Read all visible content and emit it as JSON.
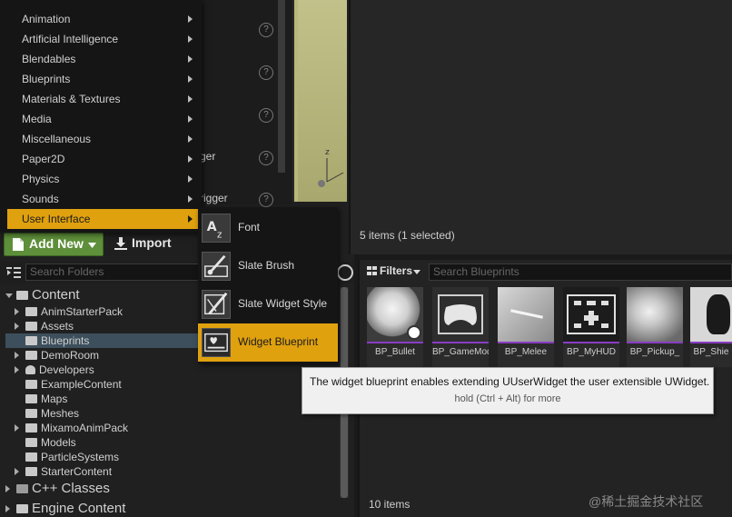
{
  "main_menu": {
    "items": [
      {
        "label": "Animation"
      },
      {
        "label": "Artificial Intelligence"
      },
      {
        "label": "Blendables"
      },
      {
        "label": "Blueprints"
      },
      {
        "label": "Materials & Textures"
      },
      {
        "label": "Media"
      },
      {
        "label": "Miscellaneous"
      },
      {
        "label": "Paper2D"
      },
      {
        "label": "Physics"
      },
      {
        "label": "Sounds"
      },
      {
        "label": "User Interface"
      }
    ]
  },
  "sub_menu": {
    "items": [
      {
        "label": "Font",
        "icon": "font-icon"
      },
      {
        "label": "Slate Brush",
        "icon": "slate-brush-icon"
      },
      {
        "label": "Slate Widget Style",
        "icon": "slate-widget-style-icon"
      },
      {
        "label": "Widget Blueprint",
        "icon": "widget-blueprint-icon"
      }
    ]
  },
  "details_fragments": {
    "a": "ger",
    "b": "rigger"
  },
  "toolbar": {
    "add_new_label": "Add New",
    "import_label": "Import"
  },
  "folders": {
    "search_placeholder": "Search Folders",
    "tree": [
      {
        "label": "Content"
      },
      {
        "label": "AnimStarterPack"
      },
      {
        "label": "Assets"
      },
      {
        "label": "Blueprints"
      },
      {
        "label": "DemoRoom"
      },
      {
        "label": "Developers"
      },
      {
        "label": "ExampleContent"
      },
      {
        "label": "Maps"
      },
      {
        "label": "Meshes"
      },
      {
        "label": "MixamoAnimPack"
      },
      {
        "label": "Models"
      },
      {
        "label": "ParticleSystems"
      },
      {
        "label": "StarterContent"
      },
      {
        "label": "C++ Classes"
      },
      {
        "label": "Engine Content"
      }
    ]
  },
  "top_panel": {
    "status": "5 items (1 selected)"
  },
  "assets": {
    "filters_label": "Filters",
    "search_placeholder": "Search Blueprints",
    "tiles": [
      {
        "label": "BP_Bullet"
      },
      {
        "label": "BP_GameModeGolden"
      },
      {
        "label": "BP_Melee"
      },
      {
        "label": "BP_MyHUD"
      },
      {
        "label": "BP_Pickup_"
      },
      {
        "label": "BP_Shie"
      }
    ],
    "count": "10 items"
  },
  "tooltip": {
    "text": "The widget blueprint enables extending UUserWidget the user extensible UWidget.",
    "hint": "hold (Ctrl + Alt) for more"
  },
  "watermark": "@稀土掘金技术社区",
  "colors": {
    "accent": "#e0a10f",
    "add_new_green": "#5e8f3a",
    "selection": "#3d4f5c",
    "blueprint_purple": "#8a3cc4"
  }
}
